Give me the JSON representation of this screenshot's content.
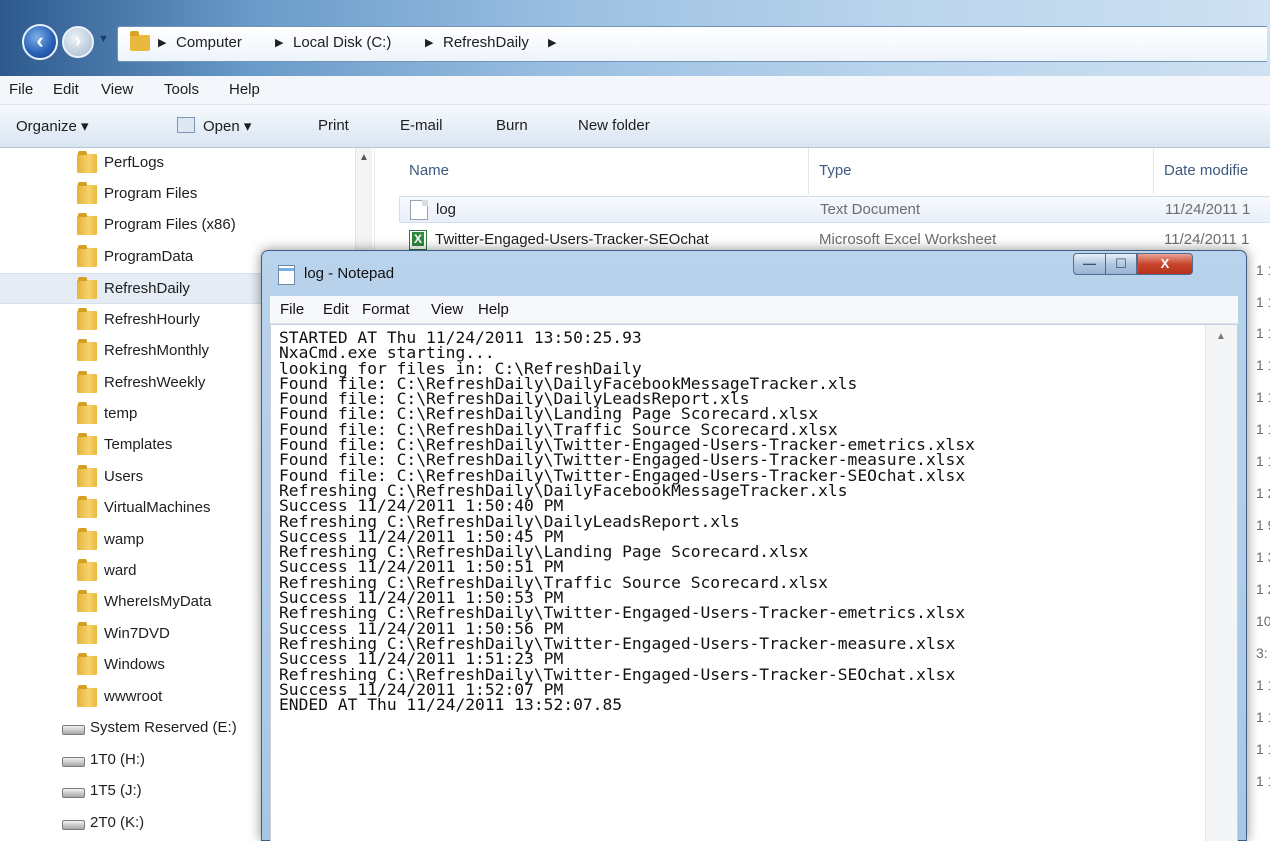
{
  "explorer": {
    "breadcrumbs": [
      "Computer",
      "Local Disk (C:)",
      "RefreshDaily"
    ],
    "menu": [
      "File",
      "Edit",
      "View",
      "Tools",
      "Help"
    ],
    "commands": {
      "organize": "Organize ▾",
      "open": "Open ▾",
      "print": "Print",
      "email": "E-mail",
      "burn": "Burn",
      "new_folder": "New folder"
    },
    "nav_folders": [
      "PerfLogs",
      "Program Files",
      "Program Files (x86)",
      "ProgramData",
      "RefreshDaily",
      "RefreshHourly",
      "RefreshMonthly",
      "RefreshWeekly",
      "temp",
      "Templates",
      "Users",
      "VirtualMachines",
      "wamp",
      "ward",
      "WhereIsMyData",
      "Win7DVD",
      "Windows",
      "wwwroot"
    ],
    "selected_folder": "RefreshDaily",
    "drives": [
      "System Reserved (E:)",
      "1T0 (H:)",
      "1T5 (J:)",
      "2T0 (K:)"
    ],
    "columns": {
      "name": "Name",
      "type": "Type",
      "date": "Date modifie"
    },
    "files": [
      {
        "name": "log",
        "type": "Text Document",
        "date": "11/24/2011 1"
      },
      {
        "name": "Twitter-Engaged-Users-Tracker-SEOchat",
        "type": "Microsoft Excel Worksheet",
        "date": "11/24/2011 1"
      }
    ],
    "date_fragments": [
      "1 1",
      "1 1",
      "1 1",
      "1 1",
      "1 1",
      "1 1",
      "1 1",
      "1 2",
      "1 9",
      "1 3",
      "1 2",
      "10:",
      "3:",
      "1 1",
      "1 1",
      "1 1",
      "1 1"
    ]
  },
  "notepad": {
    "title": "log - Notepad",
    "menu": [
      "File",
      "Edit",
      "Format",
      "View",
      "Help"
    ],
    "buttons": {
      "minimize": "—",
      "maximize": "☐",
      "close": "X"
    },
    "lines": [
      "STARTED AT Thu 11/24/2011 13:50:25.93",
      "NxaCmd.exe starting...",
      "looking for files in: C:\\RefreshDaily",
      "Found file: C:\\RefreshDaily\\DailyFacebookMessageTracker.xls",
      "Found file: C:\\RefreshDaily\\DailyLeadsReport.xls",
      "Found file: C:\\RefreshDaily\\Landing Page Scorecard.xlsx",
      "Found file: C:\\RefreshDaily\\Traffic Source Scorecard.xlsx",
      "Found file: C:\\RefreshDaily\\Twitter-Engaged-Users-Tracker-emetrics.xlsx",
      "Found file: C:\\RefreshDaily\\Twitter-Engaged-Users-Tracker-measure.xlsx",
      "Found file: C:\\RefreshDaily\\Twitter-Engaged-Users-Tracker-SEOchat.xlsx",
      "Refreshing C:\\RefreshDaily\\DailyFacebookMessageTracker.xls",
      "Success 11/24/2011 1:50:40 PM",
      "Refreshing C:\\RefreshDaily\\DailyLeadsReport.xls",
      "Success 11/24/2011 1:50:45 PM",
      "Refreshing C:\\RefreshDaily\\Landing Page Scorecard.xlsx",
      "Success 11/24/2011 1:50:51 PM",
      "Refreshing C:\\RefreshDaily\\Traffic Source Scorecard.xlsx",
      "Success 11/24/2011 1:50:53 PM",
      "Refreshing C:\\RefreshDaily\\Twitter-Engaged-Users-Tracker-emetrics.xlsx",
      "Success 11/24/2011 1:50:56 PM",
      "Refreshing C:\\RefreshDaily\\Twitter-Engaged-Users-Tracker-measure.xlsx",
      "Success 11/24/2011 1:51:23 PM",
      "Refreshing C:\\RefreshDaily\\Twitter-Engaged-Users-Tracker-SEOchat.xlsx",
      "Success 11/24/2011 1:52:07 PM",
      "ENDED AT Thu 11/24/2011 13:52:07.85"
    ]
  }
}
